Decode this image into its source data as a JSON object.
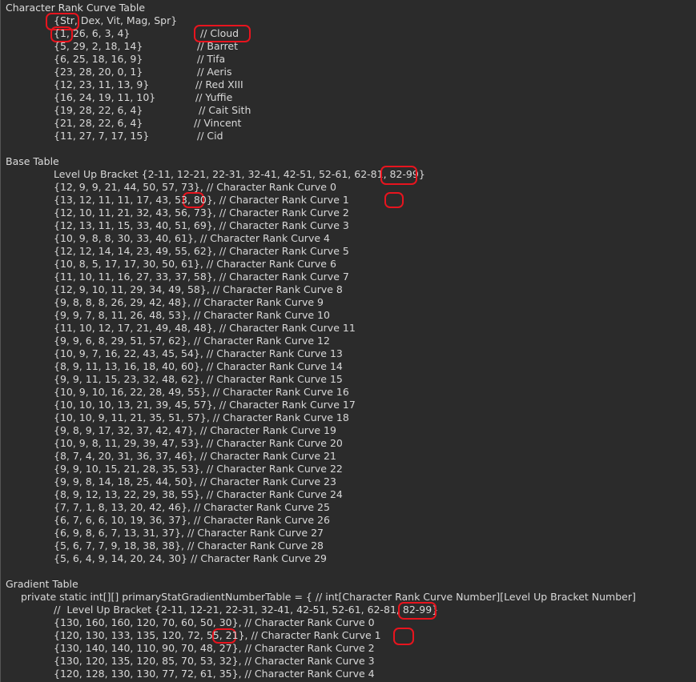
{
  "sections": {
    "rank_table": {
      "title": "Character Rank Curve Table",
      "header_row": "{Str, Dex, Vit, Mag, Spr}",
      "rows": [
        {
          "values": "{1, 26, 6, 3, 4}",
          "comment": "// Cloud"
        },
        {
          "values": "{5, 29, 2, 18, 14}",
          "comment": "// Barret"
        },
        {
          "values": "{6, 25, 18, 16, 9}",
          "comment": "// Tifa"
        },
        {
          "values": "{23, 28, 20, 0, 1}",
          "comment": "// Aeris"
        },
        {
          "values": "{12, 23, 11, 13, 9}",
          "comment": "// Red XIII"
        },
        {
          "values": "{16, 24, 19, 11, 10}",
          "comment": "// Yuffie"
        },
        {
          "values": "{19, 28, 22, 6, 4}",
          "comment": "// Cait Sith"
        },
        {
          "values": "{21, 28, 22, 6, 4}",
          "comment": "// Vincent"
        },
        {
          "values": "{11, 27, 7, 17, 15}",
          "comment": "// Cid"
        }
      ]
    },
    "base_table": {
      "title": "Base Table",
      "bracket_line": "Level Up Bracket {2-11, 12-21, 22-31, 32-41, 42-51, 52-61, 62-81, 82-99}",
      "rows": [
        "{12, 9, 9, 21, 44, 50, 57, 73}, // Character Rank Curve 0",
        "{13, 12, 11, 11, 17, 43, 53, 80}, // Character Rank Curve 1",
        "{12, 10, 11, 21, 32, 43, 56, 73}, // Character Rank Curve 2",
        "{12, 13, 11, 15, 33, 40, 51, 69}, // Character Rank Curve 3",
        "{10, 9, 8, 8, 30, 33, 40, 61}, // Character Rank Curve 4",
        "{12, 12, 14, 14, 23, 49, 55, 62}, // Character Rank Curve 5",
        "{10, 8, 5, 17, 17, 30, 50, 61}, // Character Rank Curve 6",
        "{11, 10, 11, 16, 27, 33, 37, 58}, // Character Rank Curve 7",
        "{12, 9, 10, 11, 29, 34, 49, 58}, // Character Rank Curve 8",
        "{9, 8, 8, 8, 26, 29, 42, 48}, // Character Rank Curve 9",
        "{9, 9, 7, 8, 11, 26, 48, 53}, // Character Rank Curve 10",
        "{11, 10, 12, 17, 21, 49, 48, 48}, // Character Rank Curve 11",
        "{9, 9, 6, 8, 29, 51, 57, 62}, // Character Rank Curve 12",
        "{10, 9, 7, 16, 22, 43, 45, 54}, // Character Rank Curve 13",
        "{8, 9, 11, 13, 16, 18, 40, 60}, // Character Rank Curve 14",
        "{9, 9, 11, 15, 23, 32, 48, 62}, // Character Rank Curve 15",
        "{10, 9, 10, 16, 22, 28, 49, 55}, // Character Rank Curve 16",
        "{10, 10, 10, 13, 21, 39, 45, 57}, // Character Rank Curve 17",
        "{10, 10, 9, 11, 21, 35, 51, 57}, // Character Rank Curve 18",
        "{9, 8, 9, 17, 32, 37, 42, 47}, // Character Rank Curve 19",
        "{10, 9, 8, 11, 29, 39, 47, 53}, // Character Rank Curve 20",
        "{8, 7, 4, 20, 31, 36, 37, 46}, // Character Rank Curve 21",
        "{9, 9, 10, 15, 21, 28, 35, 53}, // Character Rank Curve 22",
        "{9, 9, 8, 14, 18, 25, 44, 50}, // Character Rank Curve 23",
        "{8, 9, 12, 13, 22, 29, 38, 55}, // Character Rank Curve 24",
        "{7, 7, 1, 8, 13, 20, 42, 46}, // Character Rank Curve 25",
        "{6, 7, 6, 6, 10, 19, 36, 37}, // Character Rank Curve 26",
        "{6, 9, 8, 6, 7, 13, 31, 37}, // Character Rank Curve 27",
        "{5, 6, 7, 7, 9, 18, 38, 38}, // Character Rank Curve 28",
        "{5, 6, 4, 9, 14, 20, 24, 30} // Character Rank Curve 29"
      ]
    },
    "gradient_table": {
      "title": "Gradient Table",
      "declaration": "private static int[][] primaryStatGradientNumberTable = { // int[Character Rank Curve Number][Level Up Bracket Number]",
      "bracket_line": "//  Level Up Bracket {2-11, 12-21, 22-31, 32-41, 42-51, 52-61, 62-81, 82-99}",
      "rows": [
        "{130, 160, 160, 120, 70, 60, 50, 30}, // Character Rank Curve 0",
        "{120, 130, 133, 135, 120, 72, 55, 21}, // Character Rank Curve 1",
        "{130, 140, 140, 110, 90, 70, 48, 27}, // Character Rank Curve 2",
        "{130, 120, 135, 120, 85, 70, 53, 32}, // Character Rank Curve 3",
        "{120, 128, 130, 130, 77, 72, 61, 35}, // Character Rank Curve 4"
      ]
    }
  },
  "colors": {
    "background": "#2b2b2b",
    "text": "#d8d8d8",
    "annotation": "#e8141e"
  }
}
